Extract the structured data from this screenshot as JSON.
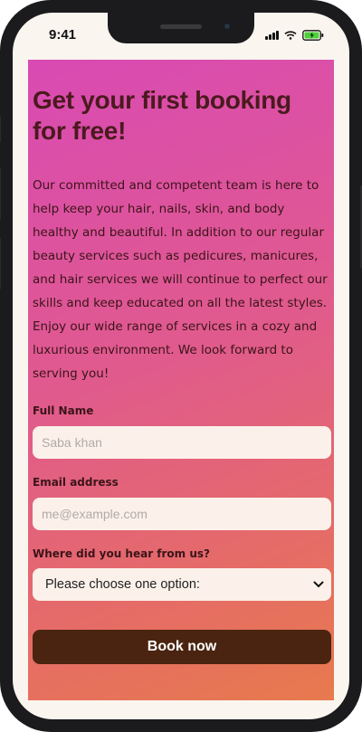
{
  "status_bar": {
    "time": "9:41",
    "icons": [
      "signal-icon",
      "wifi-icon",
      "battery-icon"
    ]
  },
  "hero": {
    "title": "Get your first booking for free!",
    "description": "Our committed and competent team is here to help keep your hair, nails, skin, and body healthy and beautiful. In addition to our regular beauty services such as pedicures, manicures, and hair services we will continue to perfect our skills and keep educated on all the latest styles. Enjoy our wide range of services in a cozy and luxurious environment. We look forward to serving you!"
  },
  "form": {
    "full_name": {
      "label": "Full Name",
      "placeholder": "Saba khan",
      "value": ""
    },
    "email": {
      "label": "Email address",
      "placeholder": "me@example.com",
      "value": ""
    },
    "source": {
      "label": "Where did you hear from us?",
      "selected": "Please choose one option:"
    },
    "submit_label": "Book now"
  },
  "colors": {
    "gradient_start": "#d94ab4",
    "gradient_end": "#e77a4d",
    "title_color": "#4a1a1e",
    "button_bg": "#4a2410",
    "field_bg": "#fbf1ea"
  }
}
